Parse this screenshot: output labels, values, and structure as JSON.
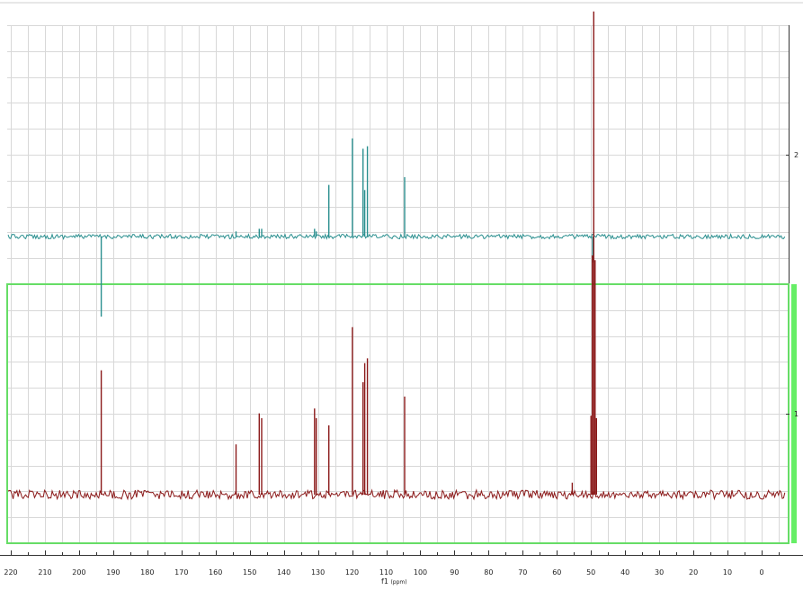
{
  "chart_data": {
    "type": "line",
    "title": "",
    "xlabel": "f1",
    "xlabel_unit": "(ppm)",
    "xlim": [
      220,
      -8
    ],
    "x_ticks": [
      "220",
      "210",
      "200",
      "190",
      "180",
      "170",
      "160",
      "150",
      "140",
      "130",
      "120",
      "110",
      "100",
      "90",
      "80",
      "70",
      "60",
      "50",
      "40",
      "30",
      "20",
      "10",
      "0"
    ],
    "y_ticks": [
      "2",
      "1"
    ],
    "grid": true,
    "selection_box": true,
    "series": [
      {
        "name": "",
        "trace": "2",
        "color": "#2a8f8f",
        "peaks": [
          {
            "x": 193.5,
            "height": -0.31
          },
          {
            "x": 154.0,
            "height": 0.02
          },
          {
            "x": 147.2,
            "height": 0.03
          },
          {
            "x": 146.5,
            "height": 0.03
          },
          {
            "x": 131.0,
            "height": 0.03
          },
          {
            "x": 130.5,
            "height": 0.02
          },
          {
            "x": 126.8,
            "height": 0.2
          },
          {
            "x": 119.9,
            "height": 0.38
          },
          {
            "x": 116.8,
            "height": 0.34
          },
          {
            "x": 116.3,
            "height": 0.18
          },
          {
            "x": 115.5,
            "height": 0.35
          },
          {
            "x": 104.6,
            "height": 0.23
          },
          {
            "x": 49.5,
            "height": -0.1
          }
        ]
      },
      {
        "name": "",
        "trace": "1",
        "color": "#8b1a1a",
        "peaks": [
          {
            "x": 193.5,
            "height": 0.52
          },
          {
            "x": 154.0,
            "height": 0.21
          },
          {
            "x": 147.2,
            "height": 0.34
          },
          {
            "x": 146.5,
            "height": 0.32
          },
          {
            "x": 131.0,
            "height": 0.36
          },
          {
            "x": 130.5,
            "height": 0.32
          },
          {
            "x": 126.8,
            "height": 0.29
          },
          {
            "x": 119.9,
            "height": 0.7
          },
          {
            "x": 116.8,
            "height": 0.47
          },
          {
            "x": 116.3,
            "height": 0.55
          },
          {
            "x": 115.5,
            "height": 0.57
          },
          {
            "x": 104.6,
            "height": 0.41
          },
          {
            "x": 55.5,
            "height": 0.05
          },
          {
            "x": 50.0,
            "height": 0.33
          },
          {
            "x": 49.6,
            "height": 1.0
          },
          {
            "x": 49.2,
            "height": 2.02
          },
          {
            "x": 48.8,
            "height": 0.98
          },
          {
            "x": 48.4,
            "height": 0.32
          }
        ]
      }
    ]
  }
}
